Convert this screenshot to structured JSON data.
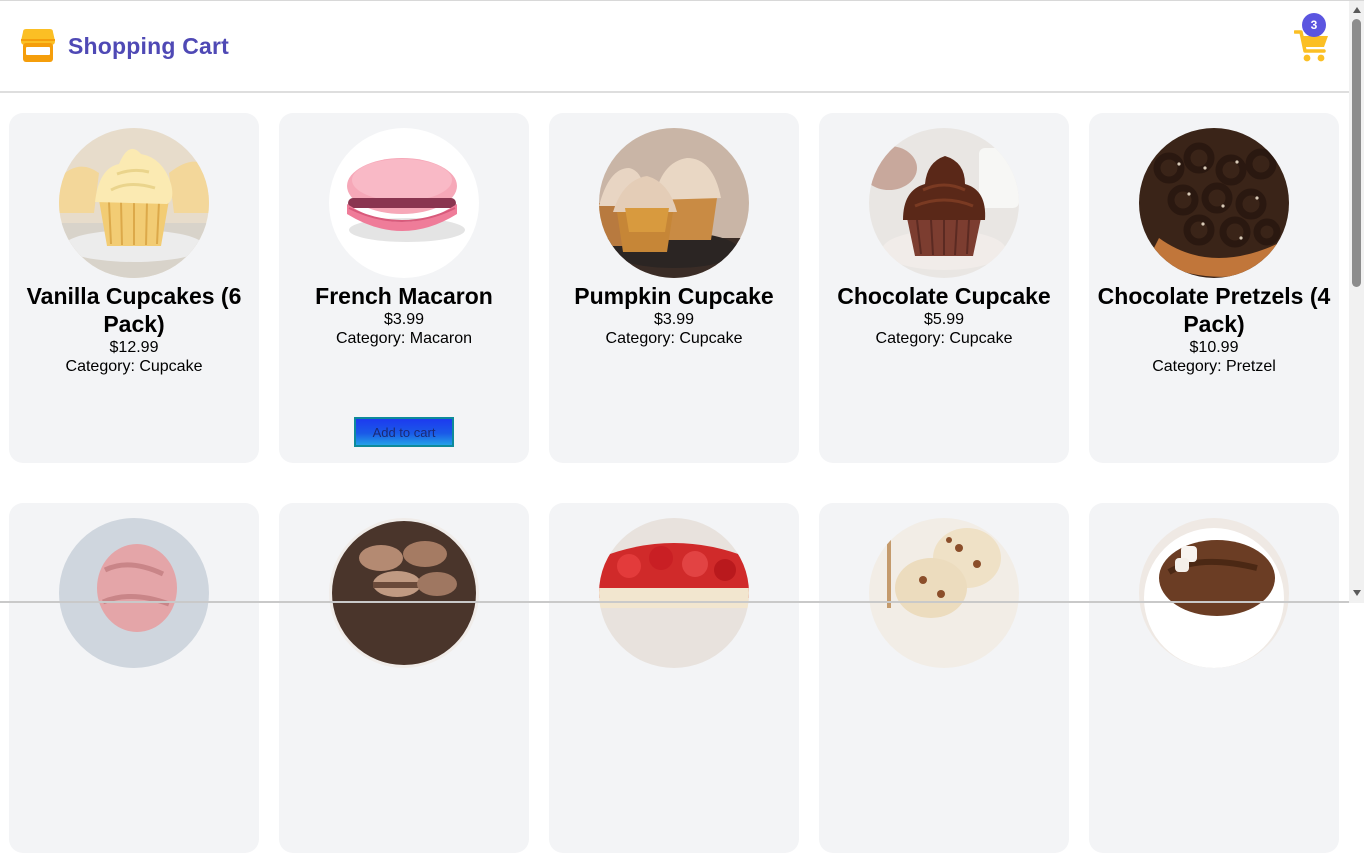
{
  "header": {
    "title": "Shopping Cart",
    "brand_icon": "storefront-icon",
    "cart_icon": "shopping-cart-icon",
    "cart_count": "3",
    "colors": {
      "title": "#4f49b5",
      "icon": "#fbbf24",
      "badge": "#5b55e0"
    }
  },
  "products": [
    {
      "name": "Vanilla Cupcakes (6 Pack)",
      "price": "$12.99",
      "category": "Category: Cupcake",
      "image": "vanilla-cupcake-image"
    },
    {
      "name": "French Macaron",
      "price": "$3.99",
      "category": "Category: Macaron",
      "image": "pink-macaron-image",
      "button": "Add to cart"
    },
    {
      "name": "Pumpkin Cupcake",
      "price": "$3.99",
      "category": "Category: Cupcake",
      "image": "pumpkin-cupcake-image"
    },
    {
      "name": "Chocolate Cupcake",
      "price": "$5.99",
      "category": "Category: Cupcake",
      "image": "chocolate-cupcake-image"
    },
    {
      "name": "Chocolate Pretzels (4 Pack)",
      "price": "$10.99",
      "category": "Category: Pretzel",
      "image": "chocolate-pretzels-image"
    },
    {
      "image": "strawberry-ice-cream-image"
    },
    {
      "image": "chocolate-macarons-image"
    },
    {
      "image": "strawberry-cheesecake-image"
    },
    {
      "image": "pecan-ice-cream-image"
    },
    {
      "image": "chocolate-ice-cream-image"
    }
  ]
}
